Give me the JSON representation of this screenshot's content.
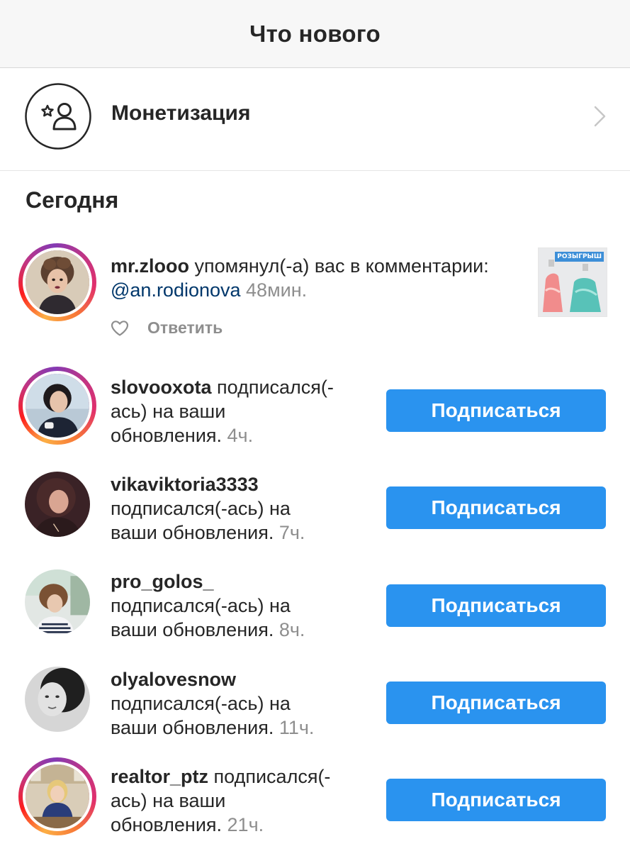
{
  "header": {
    "title": "Что нового"
  },
  "monetization": {
    "label": "Монетизация",
    "icon": "star-person-icon"
  },
  "section": {
    "title": "Сегодня"
  },
  "mention": {
    "username": "mr.zlooo",
    "text": " упомянул(-а) вас в комментарии: ",
    "handle": "@an.rodionova",
    "time": " 48мин.",
    "reply_label": "Ответить",
    "like_icon": "heart-icon",
    "thumb_badge": "РОЗЫГРЫШ"
  },
  "follow_button_label": "Подписаться",
  "followers": [
    {
      "username": "slovooxota",
      "line1_rest": " подписался(-",
      "line2": "ась) на ваши",
      "line3": "обновления.",
      "time": " 4ч."
    },
    {
      "username": "vikaviktoria3333",
      "line1_rest": "",
      "line2": "подписался(-ась) на",
      "line3": "ваши обновления.",
      "time": " 7ч."
    },
    {
      "username": "pro_golos_",
      "line1_rest": "",
      "line2": "подписался(-ась) на",
      "line3": "ваши обновления.",
      "time": " 8ч."
    },
    {
      "username": "olyalovesnow",
      "line1_rest": "",
      "line2": "подписался(-ась) на",
      "line3": "ваши обновления.",
      "time": " 11ч."
    },
    {
      "username": "realtor_ptz",
      "line1_rest": " подписался(-",
      "line2": "ась) на ваши",
      "line3": "обновления.",
      "time": " 21ч."
    }
  ],
  "colors": {
    "accent": "#2a93ef",
    "muted": "#8e8e8e",
    "link": "#00376b"
  }
}
